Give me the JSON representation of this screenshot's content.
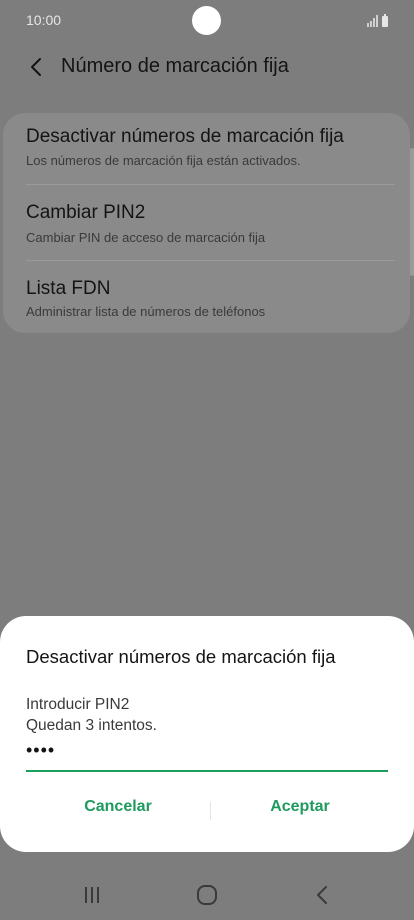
{
  "status_bar": {
    "time": "10:00"
  },
  "app_bar": {
    "title": "Número de marcación fija"
  },
  "settings": {
    "items": [
      {
        "title": "Desactivar números de marcación fija",
        "subtitle": "Los números de marcación fija están activados."
      },
      {
        "title": "Cambiar PIN2",
        "subtitle": "Cambiar PIN de acceso de marcación fija"
      },
      {
        "title": "Lista FDN",
        "subtitle": "Administrar lista de números de teléfonos"
      }
    ]
  },
  "dialog": {
    "title": "Desactivar números de marcación fija",
    "prompt": "Introducir PIN2",
    "attempts": "Quedan 3 intentos.",
    "pin_value": "••••",
    "cancel_label": "Cancelar",
    "accept_label": "Aceptar"
  },
  "colors": {
    "accent": "#1ba05c",
    "scrim": "#7d7d7d",
    "dialog_bg": "#ffffff"
  },
  "icons": {
    "back": "chevron-left-icon",
    "recents": "recents-icon",
    "home": "home-icon",
    "nav_back": "nav-back-icon"
  }
}
